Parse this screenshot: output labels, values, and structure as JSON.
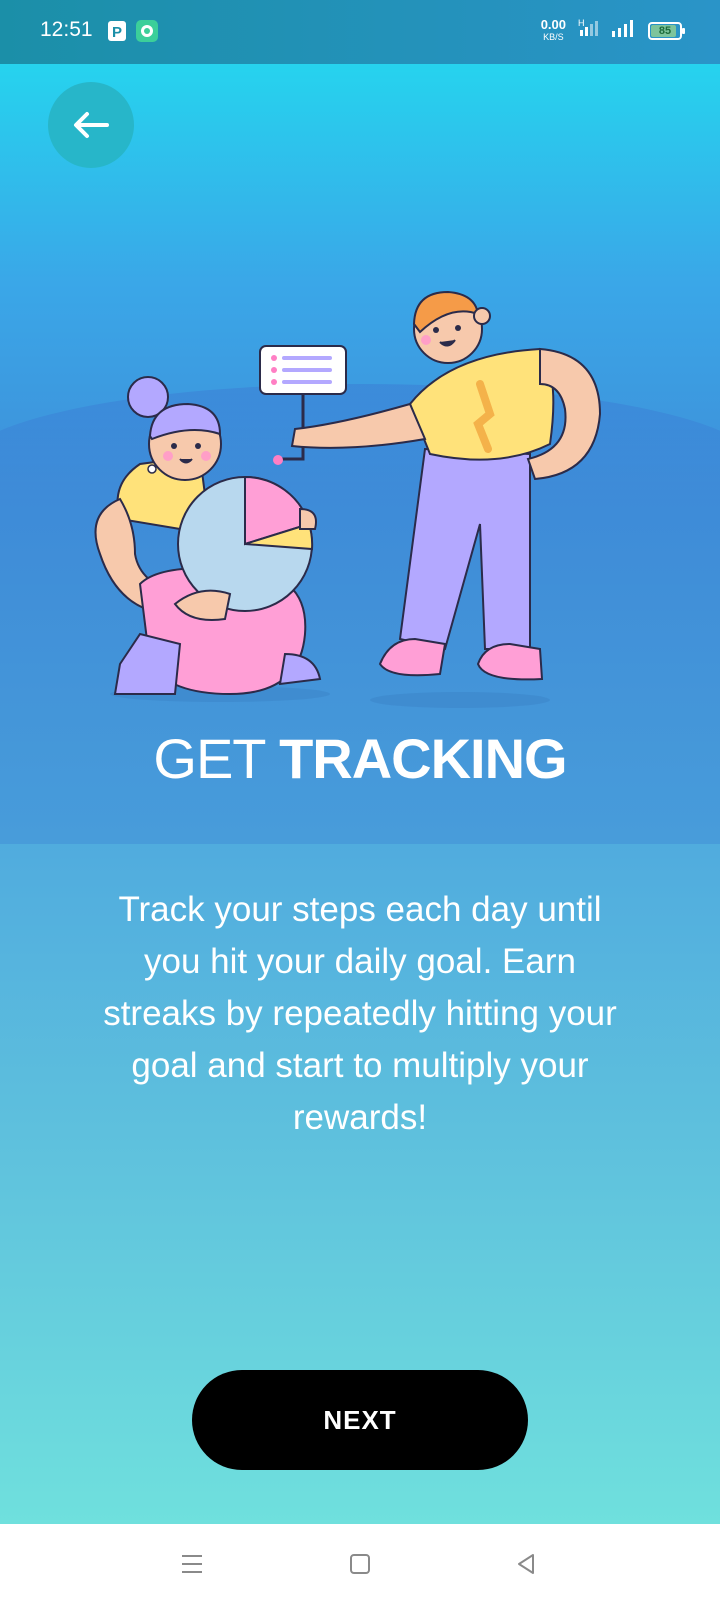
{
  "status_bar": {
    "time": "12:51",
    "netspeed_value": "0.00",
    "netspeed_unit": "KB/S",
    "battery_level": "85",
    "notification_icons": [
      "parking-icon",
      "chat-bubble-icon"
    ]
  },
  "header": {
    "back_icon": "arrow-left-icon"
  },
  "content": {
    "title_light": "GET",
    "title_bold": "TRACKING",
    "description": "Track your steps each day until you hit your daily goal. Earn streaks by repeatedly hitting your goal and start to multiply your rewards!"
  },
  "actions": {
    "next_label": "NEXT"
  },
  "navigation": {
    "items": [
      "menu-icon",
      "home-square-icon",
      "back-triangle-icon"
    ]
  },
  "colors": {
    "button_bg": "#000000",
    "back_button_bg": "#27b6c9",
    "text": "#ffffff"
  }
}
